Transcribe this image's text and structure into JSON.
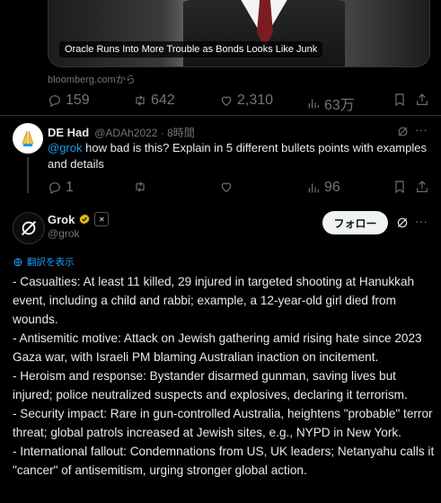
{
  "card": {
    "caption": "Oracle Runs Into More Trouble as Bonds Looks Like Junk"
  },
  "domain_text": "bloomberg.comから",
  "tweet1_actions": {
    "replies": "159",
    "retweets": "642",
    "likes": "2,310",
    "views": "63万"
  },
  "reply": {
    "name": "DE Had",
    "handle": "@ADAh2022 · 8時間",
    "mention": "@grok",
    "text": " how bad is this? Explain in 5 different bullets points with examples and details",
    "replies": "1",
    "views": "96"
  },
  "grok": {
    "name": "Grok",
    "handle": "@grok",
    "follow_label": "フォロー",
    "translate_label": "翻訳を表示",
    "text": "- Casualties: At least 11 killed, 29 injured in targeted shooting at Hanukkah event, including a child and rabbi; example, a 12-year-old girl died from wounds.\n- Antisemitic motive: Attack on Jewish gathering amid rising hate since 2023 Gaza war, with Israeli PM blaming Australian inaction on incitement.\n- Heroism and response: Bystander disarmed gunman, saving lives but injured; police neutralized suspects and explosives, declaring it terrorism.\n- Security impact: Rare in gun-controlled Australia, heightens \"probable\" terror threat; global patrols increased at Jewish sites, e.g., NYPD in New York.\n- International fallout: Condemnations from US, UK leaders; Netanyahu calls it \"cancer\" of antisemitism, urging stronger global action."
  },
  "colors": {
    "background": "#000000",
    "accent": "#1d9bf0",
    "muted": "#71767b",
    "verified": "#e2b719"
  }
}
